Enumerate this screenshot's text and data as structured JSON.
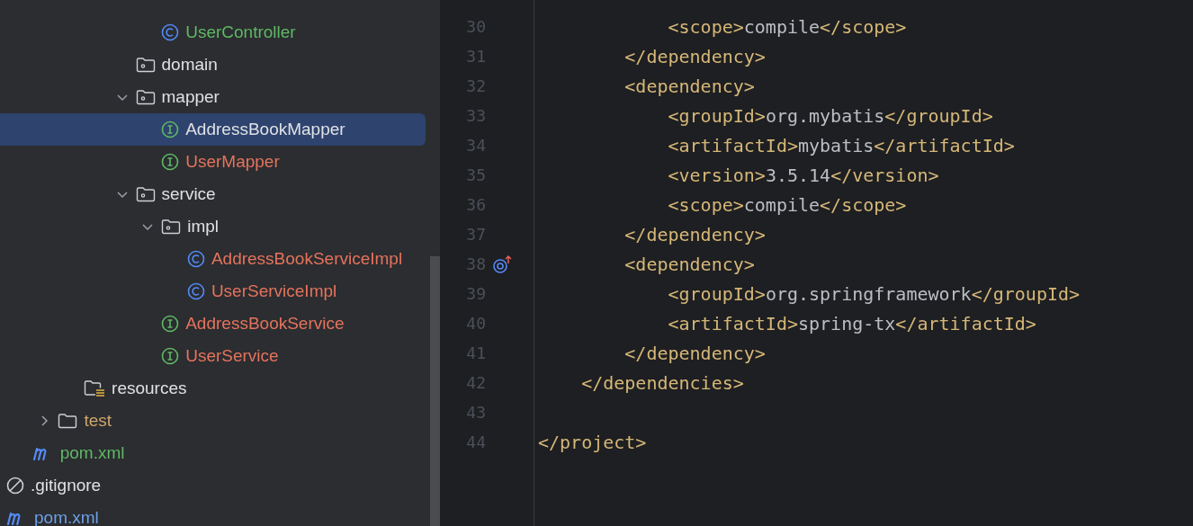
{
  "project_tree": {
    "items": [
      {
        "children": [
          {
            "children": [
              {
                "children": [
                  {
                    "children": [
                      {
                        "children": [
                          {
                            "children": [
                              {
                                "kind": "class",
                                "label": "UserController",
                                "color": "#5fb865",
                                "selected": false
                              }
                            ]
                          },
                          {
                            "kind": "package",
                            "label": "domain",
                            "color": "#dfe1e5",
                            "selected": false
                          },
                          {
                            "kind": "package",
                            "label": "mapper",
                            "color": "#dfe1e5",
                            "selected": false,
                            "expanded": true,
                            "children": [
                              {
                                "kind": "interface",
                                "label": "AddressBookMapper",
                                "color": "#dfe1e5",
                                "selected": true
                              },
                              {
                                "kind": "interface",
                                "label": "UserMapper",
                                "color": "#e5735d",
                                "selected": false
                              }
                            ]
                          },
                          {
                            "kind": "package",
                            "label": "service",
                            "color": "#dfe1e5",
                            "selected": false,
                            "expanded": true,
                            "children": [
                              {
                                "kind": "package",
                                "label": "impl",
                                "color": "#dfe1e5",
                                "selected": false,
                                "expanded": true,
                                "children": [
                                  {
                                    "kind": "class",
                                    "label": "AddressBookServiceImpl",
                                    "color": "#e5735d",
                                    "selected": false
                                  },
                                  {
                                    "kind": "class",
                                    "label": "UserServiceImpl",
                                    "color": "#e5735d",
                                    "selected": false
                                  }
                                ]
                              },
                              {
                                "kind": "interface",
                                "label": "AddressBookService",
                                "color": "#e5735d",
                                "selected": false
                              },
                              {
                                "kind": "interface",
                                "label": "UserService",
                                "color": "#e5735d",
                                "selected": false
                              }
                            ]
                          }
                        ]
                      }
                    ]
                  },
                  {
                    "kind": "resources",
                    "label": "resources",
                    "color": "#dfe1e5",
                    "selected": false
                  }
                ]
              },
              {
                "kind": "folder",
                "label": "test",
                "color": "#d0a56b",
                "selected": false,
                "expanded": false
              }
            ]
          },
          {
            "kind": "maven",
            "label": "pom.xml",
            "color": "#5fb865",
            "selected": false
          }
        ]
      },
      {
        "kind": "ignored",
        "label": ".gitignore",
        "color": "#dfe1e5",
        "selected": false
      },
      {
        "kind": "maven",
        "label": "pom.xml",
        "color": "#6e9fe8",
        "selected": false
      }
    ]
  },
  "editor": {
    "lines": [
      {
        "number": "30",
        "segments": [
          {
            "kind": "tag",
            "text": "            <scope>"
          },
          {
            "kind": "text",
            "text": "compile"
          },
          {
            "kind": "tag",
            "text": "</scope>"
          }
        ]
      },
      {
        "number": "31",
        "segments": [
          {
            "kind": "tag",
            "text": "        </dependency>"
          }
        ]
      },
      {
        "number": "32",
        "segments": [
          {
            "kind": "tag",
            "text": "        <dependency>"
          }
        ]
      },
      {
        "number": "33",
        "segments": [
          {
            "kind": "tag",
            "text": "            <groupId>"
          },
          {
            "kind": "text",
            "text": "org.mybatis"
          },
          {
            "kind": "tag",
            "text": "</groupId>"
          }
        ]
      },
      {
        "number": "34",
        "segments": [
          {
            "kind": "tag",
            "text": "            <artifactId>"
          },
          {
            "kind": "text",
            "text": "mybatis"
          },
          {
            "kind": "tag",
            "text": "</artifactId>"
          }
        ]
      },
      {
        "number": "35",
        "segments": [
          {
            "kind": "tag",
            "text": "            <version>"
          },
          {
            "kind": "text",
            "text": "3.5.14"
          },
          {
            "kind": "tag",
            "text": "</version>"
          }
        ]
      },
      {
        "number": "36",
        "segments": [
          {
            "kind": "tag",
            "text": "            <scope>"
          },
          {
            "kind": "text",
            "text": "compile"
          },
          {
            "kind": "tag",
            "text": "</scope>"
          }
        ]
      },
      {
        "number": "37",
        "segments": [
          {
            "kind": "tag",
            "text": "        </dependency>"
          }
        ]
      },
      {
        "number": "38",
        "marker": true,
        "segments": [
          {
            "kind": "tag",
            "text": "        <dependency>"
          }
        ]
      },
      {
        "number": "39",
        "segments": [
          {
            "kind": "tag",
            "text": "            <groupId>"
          },
          {
            "kind": "text",
            "text": "org.springframework"
          },
          {
            "kind": "tag",
            "text": "</groupId>"
          }
        ]
      },
      {
        "number": "40",
        "segments": [
          {
            "kind": "tag",
            "text": "            <artifactId>"
          },
          {
            "kind": "text",
            "text": "spring-tx"
          },
          {
            "kind": "tag",
            "text": "</artifactId>"
          }
        ]
      },
      {
        "number": "41",
        "segments": [
          {
            "kind": "tag",
            "text": "        </dependency>"
          }
        ]
      },
      {
        "number": "42",
        "segments": [
          {
            "kind": "tag",
            "text": "    </dependencies>"
          }
        ]
      },
      {
        "number": "43"
      },
      {
        "number": "44",
        "segments": [
          {
            "kind": "tag",
            "text": "</project>"
          }
        ]
      }
    ]
  }
}
